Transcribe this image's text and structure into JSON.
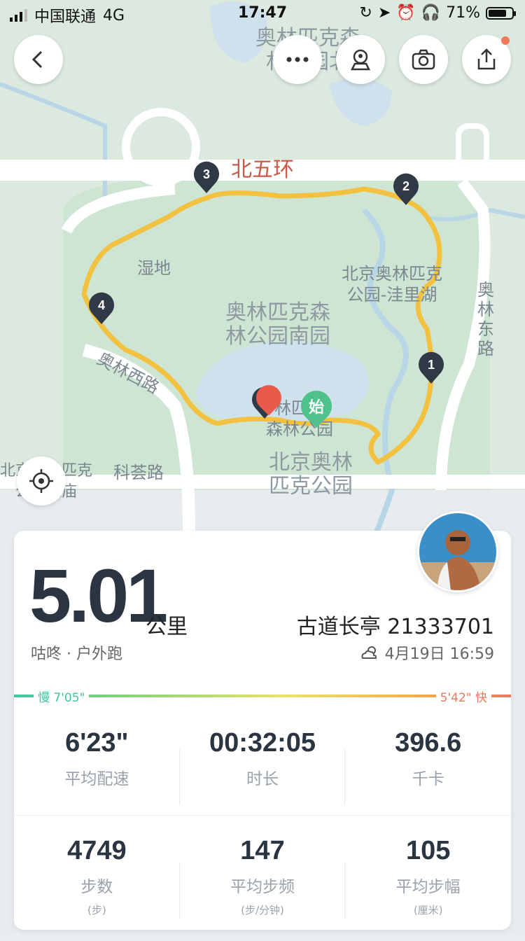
{
  "status_bar": {
    "carrier": "中国联通",
    "network": "4G",
    "time": "17:47",
    "battery": "71%"
  },
  "map": {
    "labels": {
      "top_park": "奥林匹克森\n林公园北",
      "north_ring": "北五环",
      "wetland": "湿地",
      "wali_lake": "北京奥林匹克\n公园-洼里湖",
      "south_garden": "奥林匹克森\n林公园南园",
      "east_road": "奥\n林\n东\n路",
      "west_road": "奥林西路",
      "forest_park": "林匹克\n森林公园",
      "beijing_olympic": "北京奥林\n匹克公园",
      "kehui_road": "科荟路",
      "left_temple": "北京奥林匹克\n公园王庙",
      "start_marker": "始"
    },
    "km_markers": [
      "1",
      "2",
      "3",
      "4",
      "5"
    ],
    "colors": {
      "route": "#f2c13f",
      "marker": "#2f3a46",
      "start": "#4ec28a",
      "end": "#e85b4a"
    }
  },
  "buttons": {
    "back": "back-icon",
    "more": "more-icon",
    "location": "location-pin-icon",
    "camera": "camera-icon",
    "share": "share-icon",
    "locate": "crosshair-icon"
  },
  "summary": {
    "distance": "5.01",
    "distance_unit": "公里",
    "subtitle": "咕咚 · 户外跑",
    "username": "古道长亭 21333701",
    "date": "4月19日 16:59",
    "weather_icon": "cloudy-sun-icon"
  },
  "pace": {
    "slow_label": "慢 7'05\"",
    "fast_label": "5'42\" 快"
  },
  "stats_row1": [
    {
      "value": "6'23\"",
      "label": "平均配速"
    },
    {
      "value": "00:32:05",
      "label": "时长"
    },
    {
      "value": "396.6",
      "label": "千卡"
    }
  ],
  "stats_row2": [
    {
      "value": "4749",
      "label": "步数",
      "unit": "(步)"
    },
    {
      "value": "147",
      "label": "平均步频",
      "unit": "(步/分钟)"
    },
    {
      "value": "105",
      "label": "平均步幅",
      "unit": "(厘米)"
    }
  ]
}
